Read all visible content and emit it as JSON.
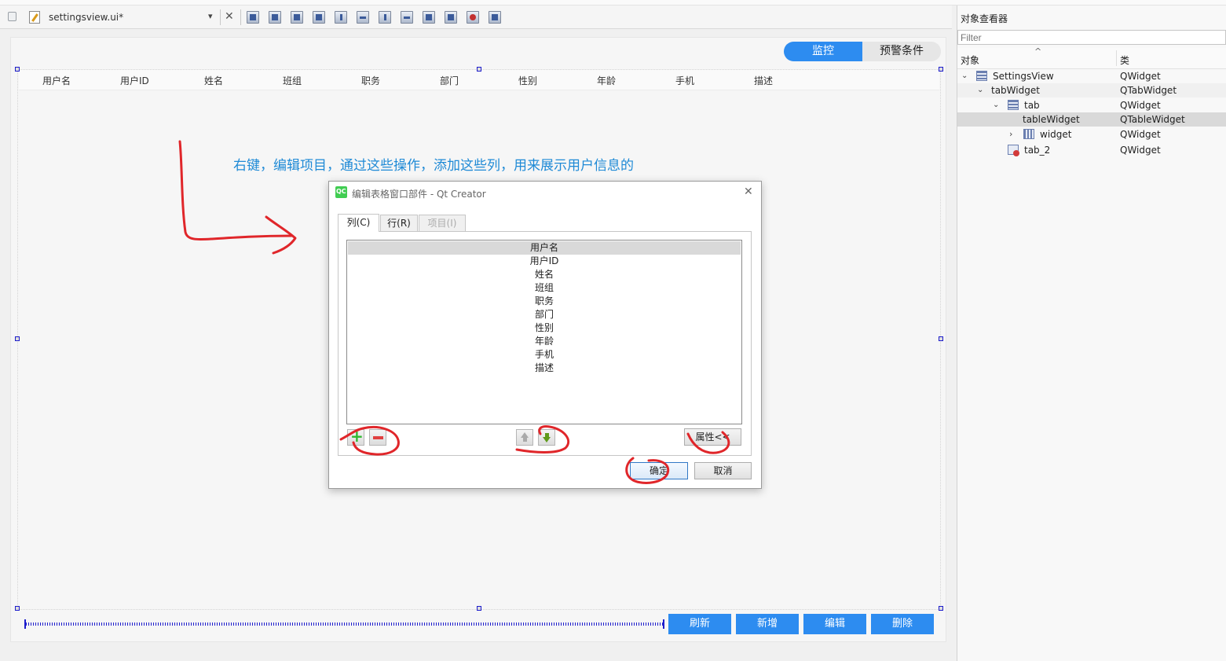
{
  "toolbar": {
    "file_name": "settingsview.ui*",
    "close_glyph": "✕",
    "dropdown_glyph": "▾",
    "icons": [
      "edit-widgets-icon",
      "edit-signals-slots-icon",
      "edit-buddies-icon",
      "edit-tab-order-icon",
      "layout-horizontal-icon",
      "layout-vertical-icon",
      "layout-horizontal-splitter-icon",
      "layout-vertical-splitter-icon",
      "layout-form-icon",
      "layout-grid-icon",
      "break-layout-icon",
      "adjust-size-icon"
    ]
  },
  "form": {
    "tabs": [
      {
        "label": "监控",
        "active": true
      },
      {
        "label": "预警条件",
        "active": false
      }
    ],
    "table_headers": [
      "用户名",
      "用户ID",
      "姓名",
      "班组",
      "职务",
      "部门",
      "性别",
      "年龄",
      "手机",
      "描述"
    ],
    "annotation": "右键，编辑项目，通过这些操作，添加这些列，用来展示用户信息的",
    "buttons": [
      "刷新",
      "新增",
      "编辑",
      "删除"
    ],
    "accent_color": "#2d8cf0",
    "annotation_color": "#1f8ad6",
    "ink_color": "#e0262a"
  },
  "object_inspector": {
    "title": "对象查看器",
    "filter_placeholder": "Filter",
    "col_object": "对象",
    "col_class": "类",
    "sort_glyph": "^",
    "rows": [
      {
        "name": "SettingsView",
        "class": "QWidget"
      },
      {
        "name": "tabWidget",
        "class": "QTabWidget"
      },
      {
        "name": "tab",
        "class": "QWidget"
      },
      {
        "name": "tableWidget",
        "class": "QTableWidget",
        "selected": true
      },
      {
        "name": "widget",
        "class": "QWidget"
      },
      {
        "name": "tab_2",
        "class": "QWidget"
      }
    ]
  },
  "dialog": {
    "icon_text": "QC",
    "title": "编辑表格窗口部件 - Qt Creator",
    "close_glyph": "✕",
    "tabs": [
      {
        "label": "列(C)",
        "active": true,
        "enabled": true
      },
      {
        "label": "行(R)",
        "active": false,
        "enabled": true
      },
      {
        "label": "项目(I)",
        "active": false,
        "enabled": false
      }
    ],
    "columns": [
      "用户名",
      "用户ID",
      "姓名",
      "班组",
      "职务",
      "部门",
      "性别",
      "年龄",
      "手机",
      "描述"
    ],
    "add_glyph": "+",
    "properties_label": "属性<<",
    "ok_label": "确定",
    "cancel_label": "取消"
  }
}
